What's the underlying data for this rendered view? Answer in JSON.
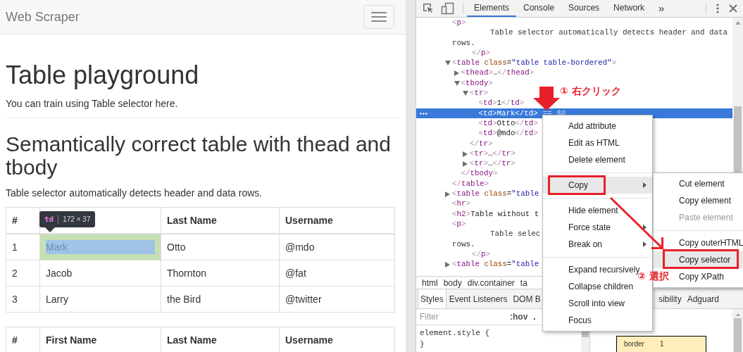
{
  "page": {
    "brand": "Web Scraper",
    "title": "Table playground",
    "intro": "You can train using Table selector here.",
    "section": {
      "title": "Semantically correct table with thead and tbody",
      "description": "Table selector automatically detects header and data rows.",
      "table": {
        "columns": [
          {
            "label": "#"
          },
          {},
          {
            "label": "Last Name"
          },
          {
            "label": "Username"
          }
        ],
        "rows": [
          {
            "cells": [
              {
                "text": "1",
                "highlighted": false
              },
              {
                "text": "Mark",
                "highlighted": true
              },
              {
                "text": "Otto",
                "highlighted": false
              },
              {
                "text": "@mdo",
                "highlighted": false
              }
            ]
          },
          {
            "cells": [
              {
                "text": "2",
                "highlighted": false
              },
              {
                "text": "Jacob",
                "highlighted": false
              },
              {
                "text": "Thornton",
                "highlighted": false
              },
              {
                "text": "@fat",
                "highlighted": false
              }
            ]
          },
          {
            "cells": [
              {
                "text": "3",
                "highlighted": false
              },
              {
                "text": "Larry",
                "highlighted": false
              },
              {
                "text": "the Bird",
                "highlighted": false
              },
              {
                "text": "@twitter",
                "highlighted": false
              }
            ]
          }
        ],
        "tooltip": {
          "tag": "td",
          "size": "172 × 37"
        }
      }
    },
    "next_table": {
      "columns": [
        "#",
        "First Name",
        "Last Name",
        "Username"
      ]
    }
  },
  "devtools": {
    "tabs": [
      {
        "label": "Elements",
        "selected": true
      },
      {
        "label": "Console",
        "selected": false
      },
      {
        "label": "Sources",
        "selected": false
      },
      {
        "label": "Network",
        "selected": false
      }
    ],
    "more_tabs": "»",
    "dom_tree": [
      {
        "tag": "<p>",
        "selected": false,
        "children": [
          {
            "text": [
              "Table selector automatically detects header and data",
              "rows."
            ]
          }
        ],
        "close": "</p>"
      },
      {
        "tag": "<table class=\"table table-bordered\">",
        "expanded": true,
        "selected": false,
        "children": [
          {
            "tag": "<thead>…</thead>",
            "expanded": false,
            "selected": false
          },
          {
            "tag": "<tbody>",
            "expanded": true,
            "selected": false,
            "children": [
              {
                "tag": "<tr>",
                "expanded": true,
                "selected": false,
                "children": [
                  {
                    "tag": "<td>1</td>",
                    "selected": false
                  },
                  {
                    "tag": "<td>Mark</td>",
                    "selected": true,
                    "suffix": "== $0"
                  },
                  {
                    "tag": "<td>Otto</td>",
                    "selected": false
                  },
                  {
                    "tag": "<td>@mdo</td>",
                    "selected": false
                  }
                ],
                "close": "</tr>"
              },
              {
                "tag": "<tr>…</tr>",
                "expanded": false,
                "selected": false
              },
              {
                "tag": "<tr>…</tr>",
                "expanded": false,
                "selected": false
              }
            ],
            "close": "</tbody>"
          }
        ],
        "close": "</table>"
      },
      {
        "tag": "<table class=\"table",
        "expanded": false,
        "selected": false
      },
      {
        "tag": "<hr>",
        "selected": false
      },
      {
        "tag": "<h2>Table without t",
        "selected": false
      },
      {
        "tag": "<p>",
        "selected": false,
        "children": [
          {
            "text": [
              "Table selec",
              "rows."
            ]
          }
        ],
        "close": "</p>"
      },
      {
        "tag": "<table class=\"table",
        "expanded": false,
        "selected": false
      }
    ],
    "breadcrumbs": [
      "html",
      "body",
      "div.container",
      "ta"
    ],
    "lower_tabs": [
      {
        "label": "Styles",
        "selected": true
      },
      {
        "label": "Event Listeners",
        "selected": false
      },
      {
        "label": "DOM B",
        "selected": false
      },
      {
        "label": "sibility",
        "selected": false
      },
      {
        "label": "Adguard",
        "selected": false
      }
    ],
    "filter": {
      "placeholder": "Filter"
    },
    "hov": ":hov",
    "cls": ".",
    "style_rule": [
      "element.style {",
      "}"
    ],
    "box_model": {
      "label": "border",
      "value": "1"
    }
  },
  "context_menu": {
    "groups": [
      [
        {
          "label": "Add attribute",
          "selected": false,
          "has_submenu": false,
          "framed": false
        },
        {
          "label": "Edit as HTML",
          "selected": false,
          "has_submenu": false,
          "framed": false
        },
        {
          "label": "Delete element",
          "selected": false,
          "has_submenu": false,
          "framed": false
        }
      ],
      [
        {
          "label": "Copy",
          "selected": true,
          "has_submenu": true,
          "framed": true
        }
      ],
      [
        {
          "label": "Hide element",
          "selected": false,
          "has_submenu": false,
          "framed": false
        },
        {
          "label": "Force state",
          "selected": false,
          "has_submenu": true,
          "framed": false
        },
        {
          "label": "Break on",
          "selected": false,
          "has_submenu": true,
          "framed": false
        }
      ],
      [
        {
          "label": "Expand recursively",
          "selected": false,
          "has_submenu": false,
          "framed": false
        },
        {
          "label": "Collapse children",
          "selected": false,
          "has_submenu": false,
          "framed": false
        },
        {
          "label": "Scroll into view",
          "selected": false,
          "has_submenu": false,
          "framed": false
        },
        {
          "label": "Focus",
          "selected": false,
          "has_submenu": false,
          "framed": false
        }
      ]
    ],
    "submenu": {
      "groups": [
        [
          {
            "label": "Cut element",
            "selected": false,
            "disabled": false,
            "framed": false
          },
          {
            "label": "Copy element",
            "selected": false,
            "disabled": false,
            "framed": false
          },
          {
            "label": "Paste element",
            "selected": false,
            "disabled": true,
            "framed": false
          }
        ],
        [
          {
            "label": "Copy outerHTML",
            "selected": false,
            "disabled": false,
            "framed": false
          },
          {
            "label": "Copy selector",
            "selected": true,
            "disabled": false,
            "framed": true
          },
          {
            "label": "Copy XPath",
            "selected": false,
            "disabled": false,
            "framed": false
          }
        ]
      ]
    }
  },
  "annotations": {
    "right_click": {
      "marker": "①",
      "label": "右クリック"
    },
    "select": {
      "marker": "②",
      "label": "選択"
    }
  }
}
